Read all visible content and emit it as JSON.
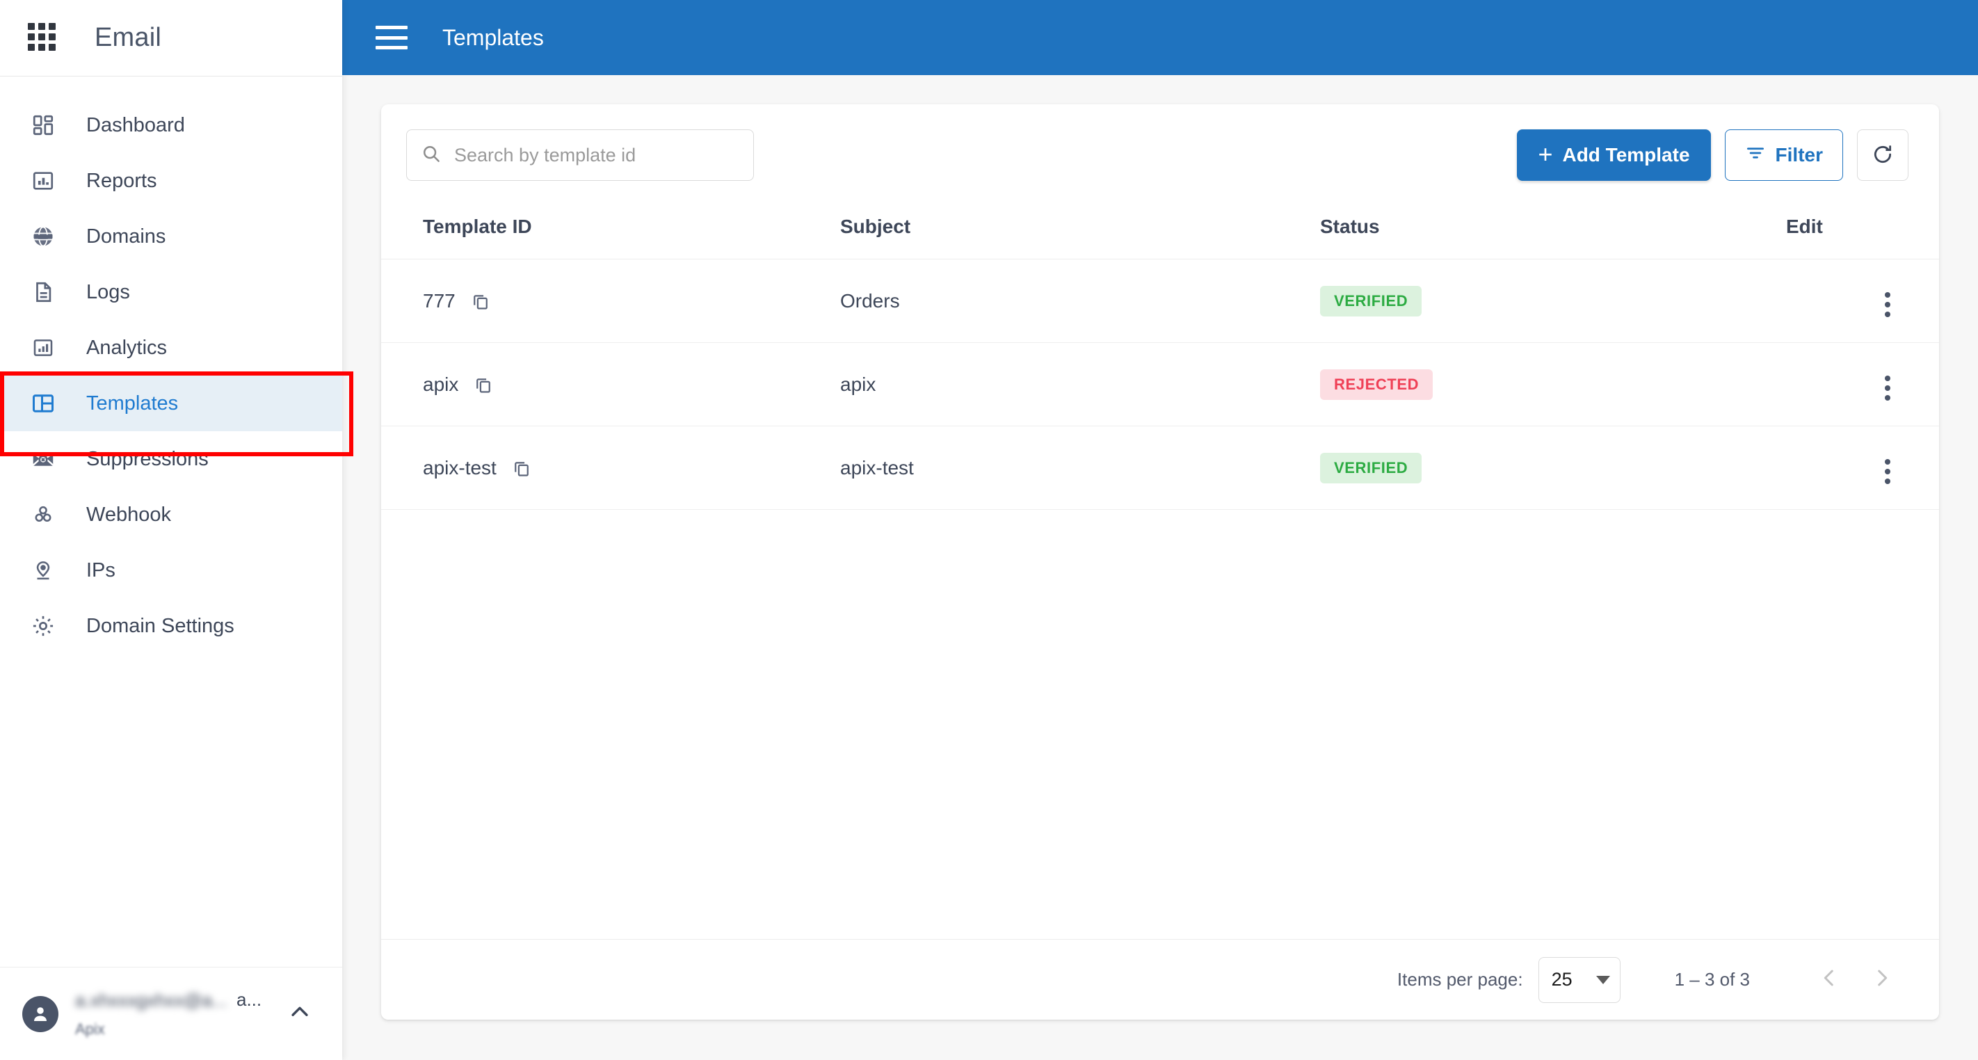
{
  "sidebar": {
    "brand_title": "Email",
    "apps_icon": "apps-grid-icon",
    "items": [
      {
        "label": "Dashboard",
        "icon": "dashboard-icon",
        "active": false
      },
      {
        "label": "Reports",
        "icon": "reports-bar-chart-icon",
        "active": false
      },
      {
        "label": "Domains",
        "icon": "globe-icon",
        "active": false
      },
      {
        "label": "Logs",
        "icon": "document-icon",
        "active": false
      },
      {
        "label": "Analytics",
        "icon": "analytics-icon",
        "active": false
      },
      {
        "label": "Templates",
        "icon": "templates-layout-icon",
        "active": true
      },
      {
        "label": "Suppressions",
        "icon": "envelope-x-icon",
        "active": false
      },
      {
        "label": "Webhook",
        "icon": "webhook-icon",
        "active": false
      },
      {
        "label": "IPs",
        "icon": "location-pin-icon",
        "active": false
      },
      {
        "label": "Domain Settings",
        "icon": "gear-icon",
        "active": false
      }
    ],
    "user": {
      "name_redacted": "a.xhxxxgxhxx@a...",
      "name_visible_tail": "a...",
      "org": "Apix",
      "expand_icon": "chevron-up-icon"
    }
  },
  "topbar": {
    "menu_icon": "hamburger-menu-icon",
    "title": "Templates",
    "background_color": "#1f73bf"
  },
  "toolbar": {
    "search": {
      "icon": "search-icon",
      "placeholder": "Search by template id",
      "value": ""
    },
    "add_template_label": "Add Template",
    "add_template_plus": "+",
    "filter_label": "Filter",
    "filter_icon": "filter-icon",
    "refresh_icon": "refresh-icon"
  },
  "table": {
    "columns": [
      "Template ID",
      "Subject",
      "Status",
      "Edit"
    ],
    "rows": [
      {
        "template_id": "777",
        "subject": "Orders",
        "status": "VERIFIED",
        "status_kind": "verified"
      },
      {
        "template_id": "apix",
        "subject": "apix",
        "status": "REJECTED",
        "status_kind": "rejected"
      },
      {
        "template_id": "apix-test",
        "subject": "apix-test",
        "status": "VERIFIED",
        "status_kind": "verified"
      }
    ],
    "copy_icon": "copy-icon",
    "row_menu_icon": "more-vertical-icon"
  },
  "footer": {
    "items_per_page_label": "Items per page:",
    "items_per_page_value": "25",
    "range_label": "1 – 3 of 3",
    "prev_icon": "chevron-left-icon",
    "next_icon": "chevron-right-icon"
  },
  "colors": {
    "accent": "#1f73bf",
    "active_nav_bg": "#e6eff6",
    "verified_text": "#2cab42",
    "verified_bg": "#dcf2de",
    "rejected_text": "#ef4056",
    "rejected_bg": "#fcdde2",
    "annotation": "#ff0000"
  }
}
